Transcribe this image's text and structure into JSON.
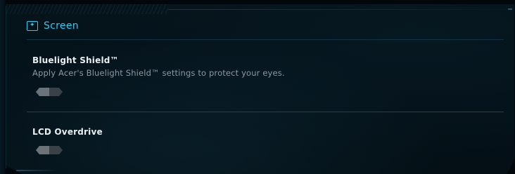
{
  "section": {
    "title": "Screen",
    "icon": "screen-sparkle-icon",
    "accent_color": "#2fc8ef"
  },
  "settings": [
    {
      "title": "Bluelight Shield™",
      "description": "Apply Acer's Bluelight Shield™ settings to protect your eyes.",
      "enabled": false
    },
    {
      "title": "LCD Overdrive",
      "description": "",
      "enabled": false
    }
  ],
  "colors": {
    "background": "#04121a",
    "title_text": "#e8eef2",
    "description_text": "#8a99a2",
    "toggle_off": "#5b6268",
    "divider": "#173747"
  }
}
